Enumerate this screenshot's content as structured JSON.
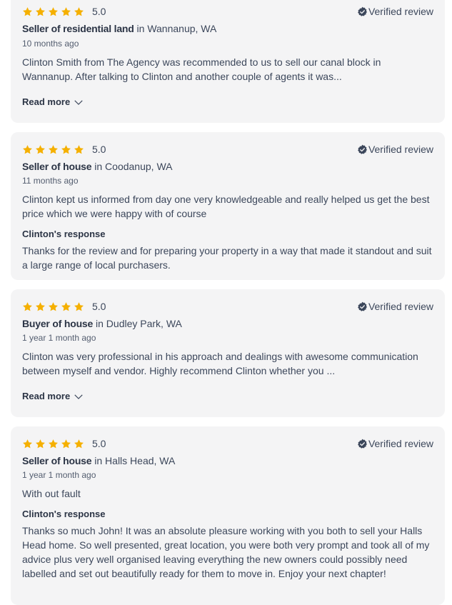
{
  "colors": {
    "star": "#f5b000",
    "card_background": "#f4f4f5",
    "text": "#3c475b",
    "verified_icon": "#3c475b"
  },
  "reviews": [
    {
      "rating": "5.0",
      "stars": 5,
      "verified_label": "Verified review",
      "role": "Seller of residential land",
      "location_prefix": "in",
      "location": "Wannanup, WA",
      "date": "10 months ago",
      "text": "Clinton Smith from The Agency was recommended to us to sell our canal block in Wannanup. After talking to Clinton and another couple of agents it was...",
      "read_more_label": "Read more"
    },
    {
      "rating": "5.0",
      "stars": 5,
      "verified_label": "Verified review",
      "role": "Seller of house",
      "location_prefix": "in",
      "location": "Coodanup, WA",
      "date": "11 months ago",
      "text": "Clinton kept us informed from day one very knowledgeable and really helped us get the best price which we were happy with of course",
      "response_title": "Clinton's response",
      "response_text": "Thanks for the review and for preparing your property in a way that made it standout and suit a large range of local purchasers."
    },
    {
      "rating": "5.0",
      "stars": 5,
      "verified_label": "Verified review",
      "role": "Buyer of house",
      "location_prefix": "in",
      "location": "Dudley Park, WA",
      "date": "1 year 1 month ago",
      "text": "Clinton was very professional in his approach and dealings with awesome communication between myself and vendor. Highly recommend Clinton whether you ...",
      "read_more_label": "Read more"
    },
    {
      "rating": "5.0",
      "stars": 5,
      "verified_label": "Verified review",
      "role": "Seller of house",
      "location_prefix": "in",
      "location": "Halls Head, WA",
      "date": "1 year 1 month ago",
      "text": "With out fault",
      "response_title": "Clinton's response",
      "response_text": "Thanks so much John! It was an absolute pleasure working with you both to sell your Halls Head home. So well presented, great location, you were both very prompt and took all of my advice plus very well organised leaving everything the new owners could possibly need labelled and set out beautifully ready for them to move in. Enjoy your next chapter!"
    }
  ]
}
